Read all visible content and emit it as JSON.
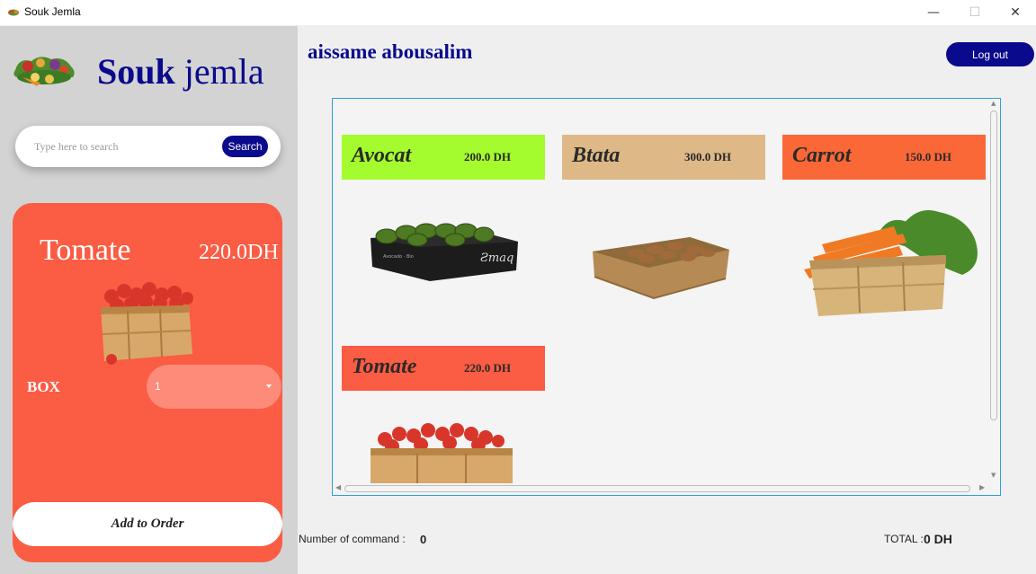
{
  "window": {
    "title": "Souk Jemla",
    "icon": "vegetables-icon",
    "controls": {
      "minimize": "—",
      "maximize": "☐",
      "close": "✕"
    }
  },
  "brand": {
    "word1": "Souk",
    "word2": "jemla",
    "logo": "vegetables-logo-icon"
  },
  "search": {
    "placeholder": "Type here to search",
    "value": "",
    "button_label": "Search"
  },
  "selected_product": {
    "name": "Tomate",
    "price": "220.0DH",
    "quantity_label": "BOX",
    "quantity_value": "1",
    "image": "tomato-crate-icon",
    "add_button_label": "Add to Order"
  },
  "user": {
    "name": "aissame abousalim"
  },
  "logout_label": "Log out",
  "products": [
    {
      "name": "Avocat",
      "price": "200.0 DH",
      "color": "#a4fb2e",
      "image": "avocado-box-icon"
    },
    {
      "name": "Btata",
      "price": "300.0 DH",
      "color": "#deb887",
      "image": "potato-crate-icon"
    },
    {
      "name": "Carrot",
      "price": "150.0 DH",
      "color": "#fb6837",
      "image": "carrot-crate-icon"
    },
    {
      "name": "Tomate",
      "price": "220.0 DH",
      "color": "#fb5c44",
      "image": "tomato-crate-icon"
    }
  ],
  "footer": {
    "command_label": "Number of command :",
    "command_count": "0",
    "total_label": "TOTAL :",
    "total_value": "0 DH"
  },
  "colors": {
    "brand": "#0a0a8c",
    "sidebar_bg": "#d3d3d3",
    "detail_card": "#fb5c44",
    "scroll_border": "#2e9fd8"
  }
}
